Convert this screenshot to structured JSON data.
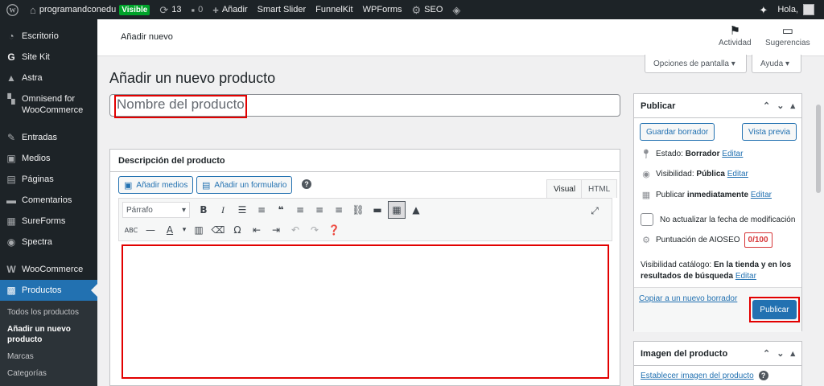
{
  "admin_bar": {
    "site_name": "programandconedu",
    "visibility_badge": "Visible",
    "updates_count": "13",
    "comments_count": "0",
    "add_new": "Añadir",
    "smart_slider": "Smart Slider",
    "funnelkit": "FunnelKit",
    "wpforms": "WPForms",
    "seo": "SEO",
    "greeting": "Hola,"
  },
  "sidebar": {
    "items": [
      {
        "label": "Escritorio",
        "icon": "dashboard-icon"
      },
      {
        "label": "Site Kit",
        "icon": "google-g-icon"
      },
      {
        "label": "Astra",
        "icon": "astra-icon"
      },
      {
        "label": "Omnisend for WooCommerce",
        "icon": "omnisend-icon"
      },
      {
        "label": "Entradas",
        "icon": "pin-icon"
      },
      {
        "label": "Medios",
        "icon": "media-icon"
      },
      {
        "label": "Páginas",
        "icon": "page-icon"
      },
      {
        "label": "Comentarios",
        "icon": "comment-icon"
      },
      {
        "label": "SureForms",
        "icon": "sureforms-icon"
      },
      {
        "label": "Spectra",
        "icon": "spectra-icon"
      },
      {
        "label": "WooCommerce",
        "icon": "woo-icon"
      },
      {
        "label": "Productos",
        "icon": "archive-icon"
      }
    ],
    "submenu": [
      {
        "label": "Todos los productos"
      },
      {
        "label": "Añadir un nuevo producto"
      },
      {
        "label": "Marcas"
      },
      {
        "label": "Categorías"
      }
    ]
  },
  "header": {
    "title": "Añadir nuevo",
    "activity": "Actividad",
    "suggestions": "Sugerencias",
    "screen_options": "Opciones de pantalla ▾",
    "help": "Ayuda ▾"
  },
  "page": {
    "heading": "Añadir un nuevo producto",
    "title_placeholder": "Nombre del producto"
  },
  "description": {
    "title": "Descripción del producto",
    "add_media": "Añadir medios",
    "add_form": "Añadir un formulario",
    "help_symbol": "?",
    "tab_visual": "Visual",
    "tab_html": "HTML",
    "format_select": "Párrafo"
  },
  "publish": {
    "title": "Publicar",
    "save_draft": "Guardar borrador",
    "preview": "Vista previa",
    "status_label": "Estado:",
    "status_value": "Borrador",
    "visibility_label": "Visibilidad:",
    "visibility_value": "Pública",
    "publish_label": "Publicar",
    "publish_value": "inmediatamente",
    "edit": "Editar",
    "no_update_date": "No actualizar la fecha de modificación",
    "aioseo_label": "Puntuación de AIOSEO",
    "aioseo_score": "0/100",
    "catalog_label": "Visibilidad catálogo:",
    "catalog_value": "En la tienda y en los resultados de búsqueda",
    "copy_draft": "Copiar a un nuevo borrador",
    "publish_button": "Publicar"
  },
  "product_image": {
    "title": "Imagen del producto",
    "set_image": "Establecer imagen del producto",
    "help_symbol": "?"
  },
  "colors": {
    "admin_dark": "#1d2327",
    "accent_blue": "#2271b1",
    "highlight_red": "#e20000",
    "success_green": "#00a32a"
  }
}
